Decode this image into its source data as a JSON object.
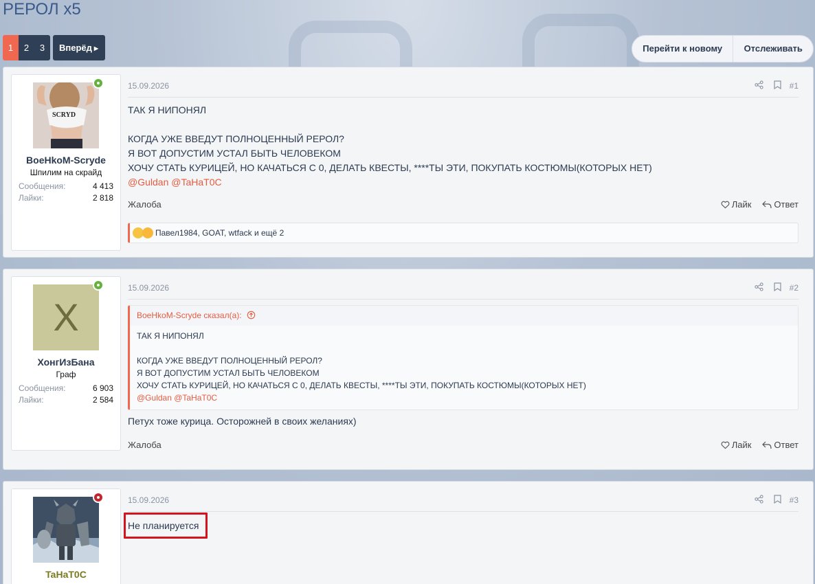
{
  "thread": {
    "title": "РЕРОЛ x5"
  },
  "pagination": {
    "pages": [
      "1",
      "2",
      "3"
    ],
    "current": "1",
    "next_label": "Вперёд"
  },
  "actions": {
    "go_to_new": "Перейти к новому",
    "watch": "Отслеживать"
  },
  "stats_labels": {
    "messages": "Сообщения:",
    "likes": "Лайки:"
  },
  "post_labels": {
    "report": "Жалоба",
    "like": "Лайк",
    "reply": "Ответ"
  },
  "posts": [
    {
      "number": "#1",
      "date": "15.09.2026",
      "author": {
        "name": "BoeHkoM-Scryde",
        "title": "Шпилим на скрайд",
        "messages": "4 413",
        "likes": "2 818",
        "status": "online"
      },
      "body_lines": [
        "ТАК Я НИПОНЯЛ",
        "",
        "КОГДА УЖЕ ВВЕДУТ ПОЛНОЦЕННЫЙ РЕРОЛ?",
        "Я ВОТ ДОПУСТИМ УСТАЛ БЫТЬ ЧЕЛОВЕКОМ",
        "ХОЧУ СТАТЬ КУРИЦЕЙ, НО КАЧАТЬСЯ С 0, ДЕЛАТЬ КВЕСТЫ, ****ТЫ ЭТИ, ПОКУПАТЬ КОСТЮМЫ(КОТОРЫХ НЕТ)"
      ],
      "mentions": [
        "@Guldan",
        "@TaHaT0C"
      ],
      "reactions_text": "Павел1984, GOAT, wtfack и ещё 2"
    },
    {
      "number": "#2",
      "date": "15.09.2026",
      "author": {
        "name": "ХонгИзБана",
        "title": "Граф",
        "messages": "6 903",
        "likes": "2 584",
        "avatar_letter": "X",
        "status": "online"
      },
      "quote": {
        "header": "BoeHkoM-Scryde сказал(а):",
        "lines": [
          "ТАК Я НИПОНЯЛ",
          "",
          "КОГДА УЖЕ ВВЕДУТ ПОЛНОЦЕННЫЙ РЕРОЛ?",
          "Я ВОТ ДОПУСТИМ УСТАЛ БЫТЬ ЧЕЛОВЕКОМ",
          "ХОЧУ СТАТЬ КУРИЦЕЙ, НО КАЧАТЬСЯ С 0, ДЕЛАТЬ КВЕСТЫ, ****ТЫ ЭТИ, ПОКУПАТЬ КОСТЮМЫ(КОТОРЫХ НЕТ)"
        ],
        "mentions": [
          "@Guldan",
          "@TaHaT0C"
        ]
      },
      "body": "Петух тоже курица. Осторожней в своих желаниях)"
    },
    {
      "number": "#3",
      "date": "15.09.2026",
      "author": {
        "name": "TaHaT0C",
        "status": "offline"
      },
      "body": "Не планируется"
    }
  ],
  "colors": {
    "accent": "#f0684f",
    "link": "#e55b3f",
    "dark": "#2f3f56",
    "online": "#63b23c",
    "offline": "#c2272d",
    "highlight": "#d4141c"
  },
  "icons": [
    "share-icon",
    "bookmark-icon",
    "heart-icon",
    "reply-arrow-icon",
    "quote-up-arrow-icon"
  ]
}
